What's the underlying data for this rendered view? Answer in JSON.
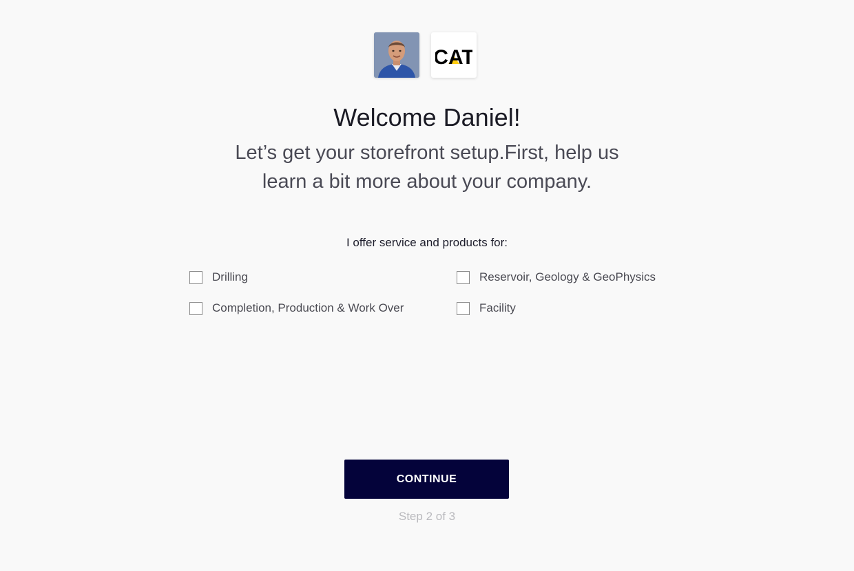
{
  "header": {
    "title": "Welcome Daniel!",
    "subtitle": "Let’s get your storefront setup.First, help us learn a bit more about your company."
  },
  "company": {
    "logo_text": "CAT"
  },
  "form": {
    "question": "I offer service and products for:",
    "options": [
      {
        "label": "Drilling",
        "checked": false
      },
      {
        "label": "Reservoir, Geology & GeoPhysics",
        "checked": false
      },
      {
        "label": "Completion, Production & Work Over",
        "checked": false
      },
      {
        "label": "Facility",
        "checked": false
      }
    ]
  },
  "footer": {
    "continue_label": "CONTINUE",
    "step_text": "Step 2 of 3"
  },
  "colors": {
    "primary": "#04033a",
    "background": "#f9f9f9",
    "cat_yellow": "#ffcd11"
  }
}
